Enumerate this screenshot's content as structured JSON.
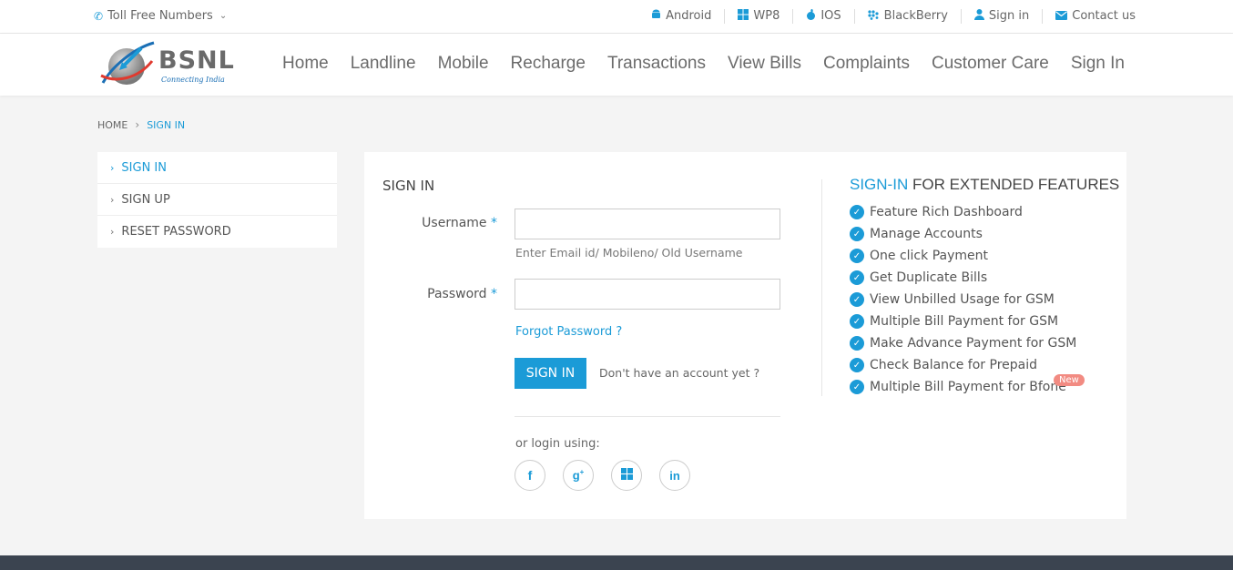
{
  "topbar": {
    "tollfree": "Toll Free Numbers",
    "links": [
      {
        "icon": "android-icon",
        "label": "Android"
      },
      {
        "icon": "windows-icon",
        "label": "WP8"
      },
      {
        "icon": "apple-icon",
        "label": "IOS"
      },
      {
        "icon": "blackberry-icon",
        "label": "BlackBerry"
      },
      {
        "icon": "user-icon",
        "label": "Sign in"
      },
      {
        "icon": "envelope-icon",
        "label": "Contact us"
      }
    ]
  },
  "brand": {
    "name": "BSNL",
    "tagline": "Connecting India"
  },
  "nav": [
    "Home",
    "Landline",
    "Mobile",
    "Recharge",
    "Transactions",
    "View Bills",
    "Complaints",
    "Customer Care",
    "Sign In"
  ],
  "breadcrumb": {
    "home": "HOME",
    "current": "SIGN IN"
  },
  "sidemenu": [
    "SIGN IN",
    "SIGN UP",
    "RESET PASSWORD"
  ],
  "form": {
    "title": "SIGN IN",
    "username_label": "Username",
    "username_value": "",
    "username_hint": "Enter Email id/ Mobileno/ Old Username",
    "password_label": "Password",
    "password_value": "",
    "required_mark": "*",
    "forgot": "Forgot Password ?",
    "submit": "SIGN IN",
    "no_account": "Don't have an account yet ?",
    "or_login": "or login using:"
  },
  "features": {
    "title_highlight": "SIGN-IN",
    "title_rest": " FOR EXTENDED FEATURES",
    "items": [
      "Feature Rich Dashboard",
      "Manage Accounts",
      "One click Payment",
      "Get Duplicate Bills",
      "View Unbilled Usage for GSM",
      "Multiple Bill Payment for GSM",
      "Make Advance Payment for GSM",
      "Check Balance for Prepaid",
      "Multiple Bill Payment for Bfone"
    ],
    "new_badge": "New"
  },
  "colors": {
    "accent": "#1b9bd7",
    "badge": "#f28b82",
    "footer": "#3b4450"
  }
}
